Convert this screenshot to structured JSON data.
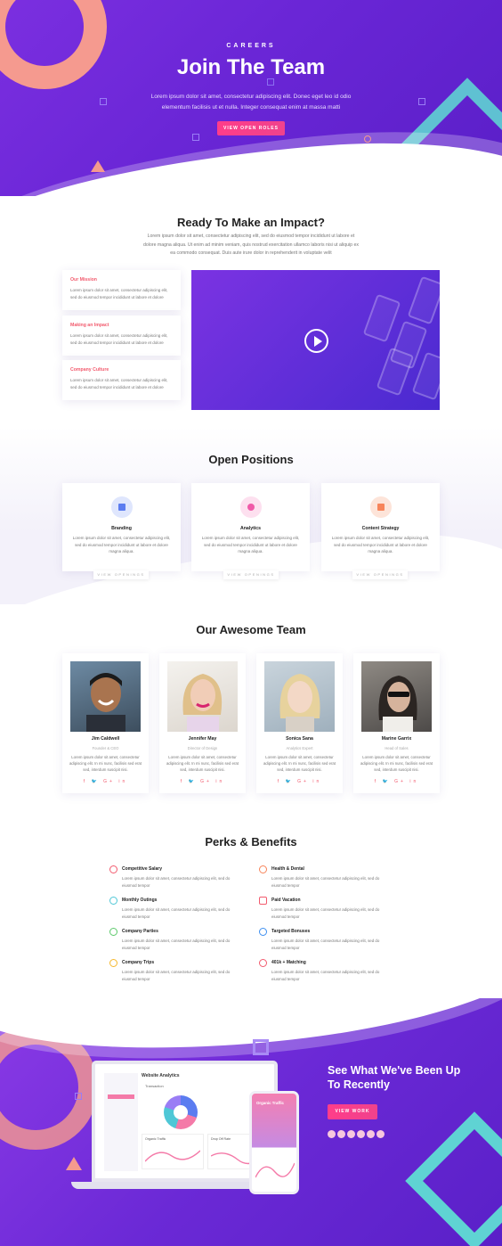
{
  "hero": {
    "eyebrow": "CAREERS",
    "title": "Join The Team",
    "text": "Lorem ipsum dolor sit amet, consectetur adipiscing elit. Donec eget leo id odio elementum facilisis ut et nulla. Integer consequat enim at massa matti",
    "button": "VIEW OPEN ROLES"
  },
  "impact": {
    "title": "Ready To Make an Impact?",
    "text": "Lorem ipsum dolor sit amet, consectetur adipiscing elit, sed do eiusmod tempor incididunt ut labore et dolore magna aliqua. Ut enim ad minim veniam, quis nostrud exercitation ullamco laboris nisi ut aliquip ex ea commodo consequat. Duis aute irure dolor in reprehenderit in voluptate velit",
    "cards": [
      {
        "title": "Our Mission",
        "text": "Lorem ipsum dolor sit amet, consectetur adipiscing elit, sed do eiusmod tempor incididunt ut labore et dolore"
      },
      {
        "title": "Making an Impact",
        "text": "Lorem ipsum dolor sit amet, consectetur adipiscing elit, sed do eiusmod tempor incididunt ut labore et dolore"
      },
      {
        "title": "Company Culture",
        "text": "Lorem ipsum dolor sit amet, consectetur adipiscing elit, sed do eiusmod tempor incididunt ut labore et dolore"
      }
    ]
  },
  "positions": {
    "title": "Open Positions",
    "items": [
      {
        "title": "Branding",
        "text": "Lorem ipsum dolor sit amet, consectetur adipiscing elit, sed do eiusmod tempor incididunt ut labore et dolore magna aliqua.",
        "button": "VIEW OPENINGS",
        "icon": "briefcase-icon",
        "color": "#5b7cf0",
        "bg": "#dfe6fd"
      },
      {
        "title": "Analytics",
        "text": "Lorem ipsum dolor sit amet, consectetur adipiscing elit, sed do eiusmod tempor incididunt ut labore et dolore magna aliqua.",
        "button": "VIEW OPENINGS",
        "icon": "pie-chart-icon",
        "color": "#f05aa8",
        "bg": "#fde0ef"
      },
      {
        "title": "Content Strategy",
        "text": "Lorem ipsum dolor sit amet, consectetur adipiscing elit, sed do eiusmod tempor incididunt ut labore et dolore magna aliqua.",
        "button": "VIEW OPENINGS",
        "icon": "document-icon",
        "color": "#f7845a",
        "bg": "#fde4d9"
      }
    ]
  },
  "team": {
    "title": "Our Awesome Team",
    "members": [
      {
        "name": "Jim Caldwell",
        "role": "Founder & CEO",
        "text": "Lorem ipsum dolor sit amet, consectetur adipiscing elit. In mi nunc, facilisis sed erat sed, interdum suscipit nisi.",
        "social": "f  🐦 G+ in"
      },
      {
        "name": "Jennifer May",
        "role": "Director of Design",
        "text": "Lorem ipsum dolor sit amet, consectetur adipiscing elit. In mi nunc, facilisis sed erat sed, interdum suscipit nisi.",
        "social": "f  🐦 G+ in"
      },
      {
        "name": "Sonica Sana",
        "role": "Analytics Expert",
        "text": "Lorem ipsum dolor sit amet, consectetur adipiscing elit. In mi nunc, facilisis sed erat sed, interdum suscipit nisi.",
        "social": "f  🐦 G+ in"
      },
      {
        "name": "Marine Garrix",
        "role": "Head of Sales",
        "text": "Lorem ipsum dolor sit amet, consectetur adipiscing elit. In mi nunc, facilisis sed erat sed, interdum suscipit nisi.",
        "social": "f  🐦 G+ in"
      }
    ]
  },
  "perks": {
    "title": "Perks & Benefits",
    "items": [
      {
        "title": "Competitive Salary",
        "text": "Lorem ipsum dolor sit amet, consectetur adipiscing elit, sed do eiusmod tempor",
        "color": "#f25b6e",
        "icon": "clock-icon"
      },
      {
        "title": "Health & Dental",
        "text": "Lorem ipsum dolor sit amet, consectetur adipiscing elit, sed do eiusmod tempor",
        "color": "#f7845a",
        "icon": "check-icon"
      },
      {
        "title": "Monthly Outings",
        "text": "Lorem ipsum dolor sit amet, consectetur adipiscing elit, sed do eiusmod tempor",
        "color": "#4fc7d6",
        "icon": "search-icon"
      },
      {
        "title": "Paid Vacation",
        "text": "Lorem ipsum dolor sit amet, consectetur adipiscing elit, sed do eiusmod tempor",
        "color": "#f25b6e",
        "icon": "lock-icon"
      },
      {
        "title": "Company Parties",
        "text": "Lorem ipsum dolor sit amet, consectetur adipiscing elit, sed do eiusmod tempor",
        "color": "#5cc96b",
        "icon": "cube-icon"
      },
      {
        "title": "Targeted Bonuses",
        "text": "Lorem ipsum dolor sit amet, consectetur adipiscing elit, sed do eiusmod tempor",
        "color": "#3d8ff0",
        "icon": "rocket-icon"
      },
      {
        "title": "Company Trips",
        "text": "Lorem ipsum dolor sit amet, consectetur adipiscing elit, sed do eiusmod tempor",
        "color": "#f5b82e",
        "icon": "plane-icon"
      },
      {
        "title": "401k + Matching",
        "text": "Lorem ipsum dolor sit amet, consectetur adipiscing elit, sed do eiusmod tempor",
        "color": "#f25b6e",
        "icon": "dashboard-icon"
      }
    ]
  },
  "footer": {
    "title": "See What We've Been Up To Recently",
    "button": "VIEW WORK",
    "laptop_title": "Website Analytics",
    "laptop_sub": "Transaction",
    "card1": "Organic Traffic",
    "card2": "Drop Off Rate",
    "phone_title": "Organic Traffic"
  }
}
